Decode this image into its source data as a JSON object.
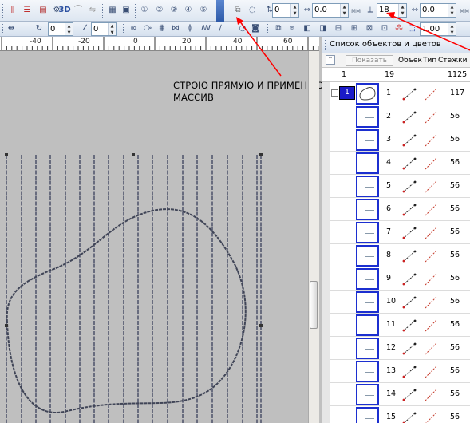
{
  "toolbar": {
    "label_3d": "3D",
    "spin_a": "0",
    "spin_b": "0.0",
    "spin_c": "18",
    "spin_d": "0.0",
    "unit_mm": "мм",
    "spin_width_1": "0",
    "spin_width_2": "0",
    "density": "1.00"
  },
  "ruler": {
    "labels": [
      "-40",
      "-20",
      "0",
      "20",
      "40",
      "60"
    ]
  },
  "annotation": {
    "line1": "СТРОЮ ПРЯМУЮ И ПРИМЕНЯЮ",
    "line2": "МАССИВ"
  },
  "panel": {
    "title": "Список объектов и цветов",
    "show_button": "Показать",
    "col_object": "Объект",
    "col_type": "Тип",
    "col_stitches": "Стежки",
    "count_left": "1",
    "count_mid": "19",
    "count_right": "1125",
    "group_label": "1",
    "rows": [
      {
        "num": "1",
        "stitches": "117"
      },
      {
        "num": "2",
        "stitches": "56"
      },
      {
        "num": "3",
        "stitches": "56"
      },
      {
        "num": "4",
        "stitches": "56"
      },
      {
        "num": "5",
        "stitches": "56"
      },
      {
        "num": "6",
        "stitches": "56"
      },
      {
        "num": "7",
        "stitches": "56"
      },
      {
        "num": "8",
        "stitches": "56"
      },
      {
        "num": "9",
        "stitches": "56"
      },
      {
        "num": "10",
        "stitches": "56"
      },
      {
        "num": "11",
        "stitches": "56"
      },
      {
        "num": "12",
        "stitches": "56"
      },
      {
        "num": "13",
        "stitches": "56"
      },
      {
        "num": "14",
        "stitches": "56"
      },
      {
        "num": "15",
        "stitches": "56"
      }
    ]
  },
  "colors": {
    "selection_blue": "#1c2fd0",
    "annotation_arrow": "#ff0000",
    "stitch_line": "#3a3f5c"
  }
}
